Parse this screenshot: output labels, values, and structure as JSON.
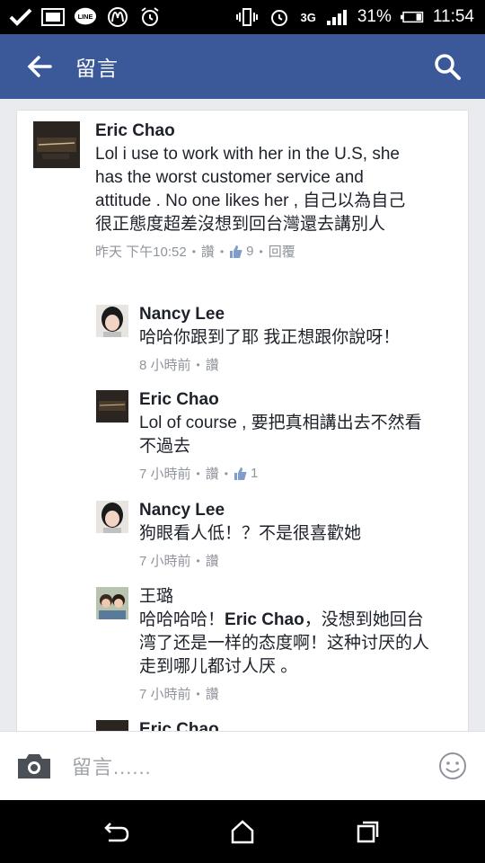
{
  "status_bar": {
    "battery_percent": "31%",
    "time": "11:54",
    "network": "3G",
    "line_label": "LINE"
  },
  "app_bar": {
    "title": "留言"
  },
  "comments": [
    {
      "author": "Eric Chao",
      "text": "Lol i use to work with her in the U.S, she has the worst customer service and attitude . No one likes her , 自己以為自己很正態度超差沒想到回台灣還去講別人",
      "time": "昨天 下午10:52",
      "like_action": "讚",
      "like_count": "9",
      "reply_action": "回覆"
    },
    {
      "author": "Nancy Lee",
      "text": "哈哈你跟到了耶 我正想跟你說呀！",
      "time": "8 小時前",
      "like_action": "讚"
    },
    {
      "author": "Eric Chao",
      "text": "Lol of course , 要把真相講出去不然看不過去",
      "time": "7 小時前",
      "like_action": "讚",
      "like_count": "1"
    },
    {
      "author": "Nancy Lee",
      "text": "狗眼看人低！？不是很喜歡她",
      "time": "7 小時前",
      "like_action": "讚"
    },
    {
      "author": "王璐",
      "text_before": "哈哈哈哈！",
      "mention": "Eric Chao",
      "text_after": "，没想到她回台湾了还是一样的态度啊！这种讨厌的人 走到哪儿都讨人厌 。",
      "time": "7 小時前",
      "like_action": "讚"
    },
    {
      "author": "Eric Chao"
    }
  ],
  "composer": {
    "placeholder": "留言......"
  },
  "colors": {
    "brand": "#3b5998",
    "meta": "#90949c",
    "text": "#1d2129"
  }
}
